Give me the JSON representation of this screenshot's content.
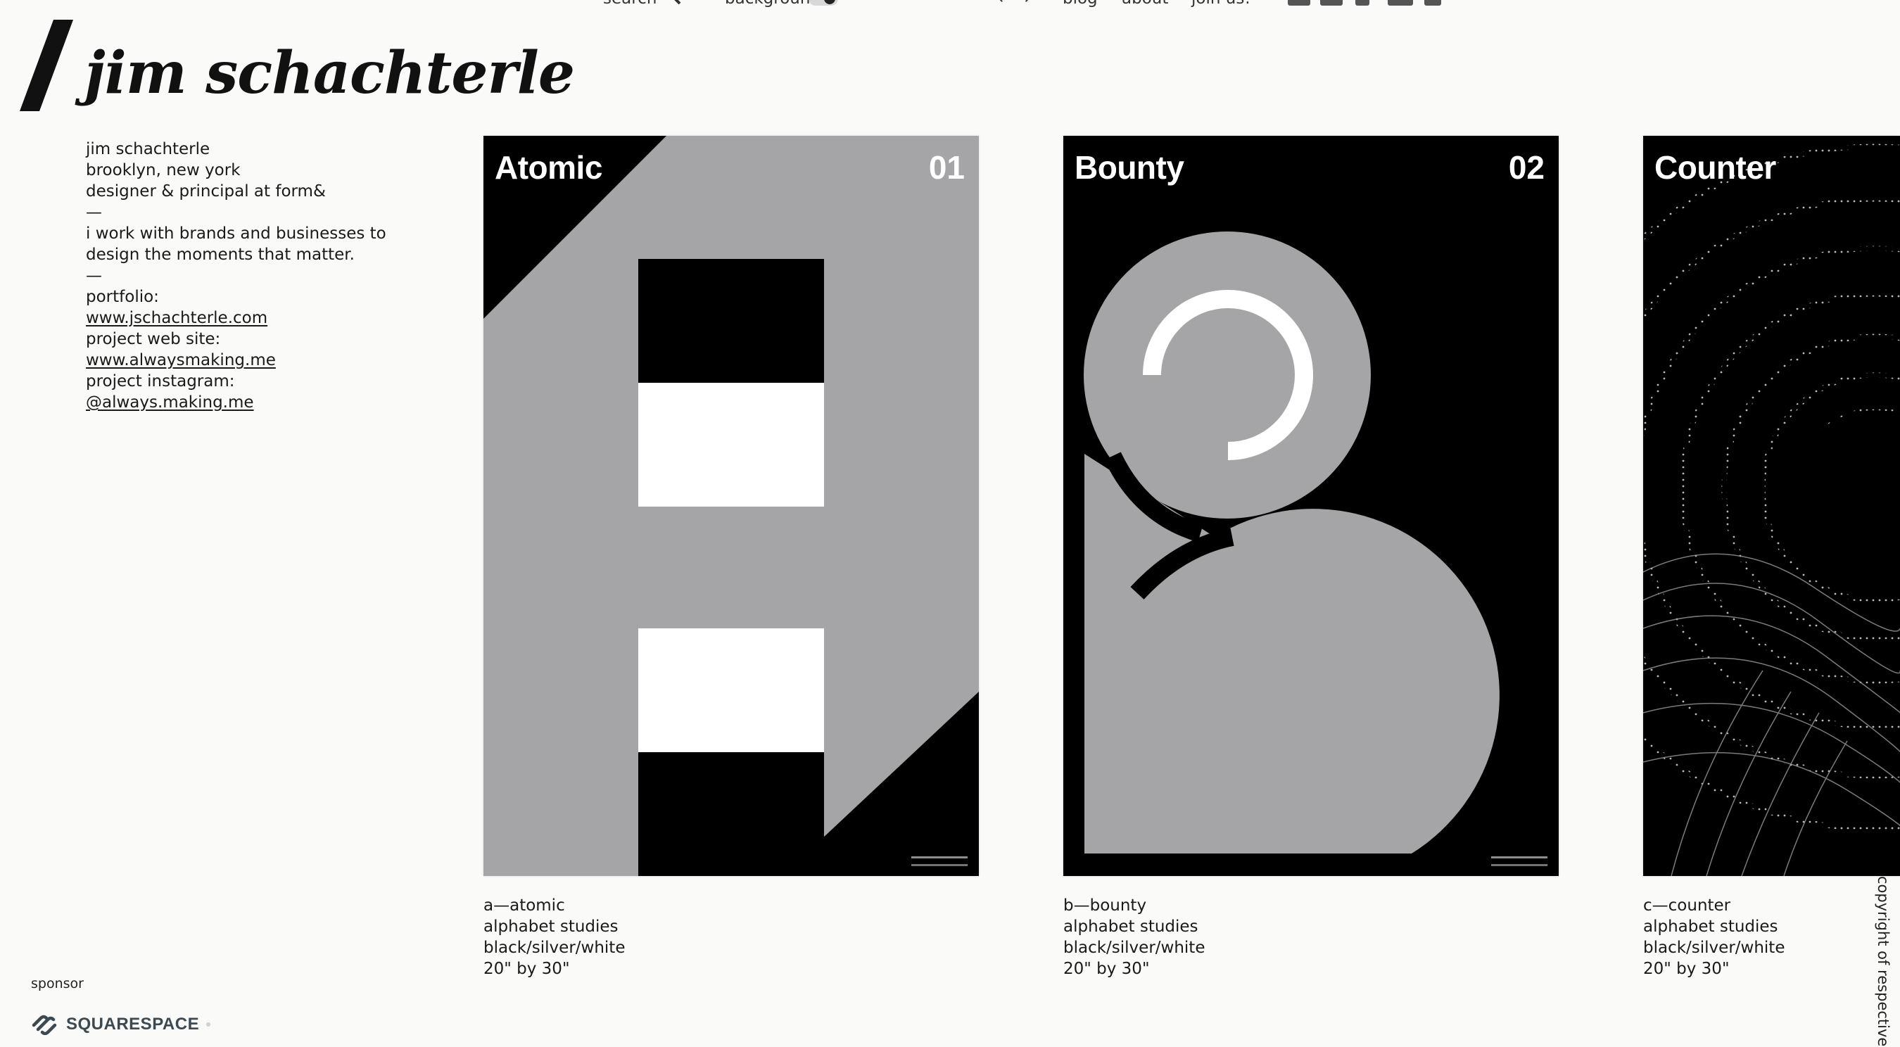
{
  "nav": {
    "search_label": "search",
    "background_label": "background",
    "blog_label": "blog",
    "about_label": "about",
    "join_label": "join us!",
    "arrows_label": "← →"
  },
  "header": {
    "site_title": "jim schachterle"
  },
  "bio": {
    "name": "jim schachterle",
    "location": "brooklyn, new york",
    "role": "designer & principal at form&",
    "dash1": "—",
    "statement_line1": "i work with brands and businesses to",
    "statement_line2": "design the moments that matter.",
    "dash2": "—",
    "portfolio_label": "portfolio:",
    "portfolio_link": "www.jschachterle.com",
    "project_site_label": "project web site:",
    "project_site_link": "www.alwaysmaking.me",
    "instagram_label": "project instagram:",
    "instagram_link": "@always.making.me"
  },
  "posters": [
    {
      "title": "Atomic",
      "number": "01",
      "caption": [
        "a—atomic",
        "alphabet studies",
        "black/silver/white",
        "20\" by 30\""
      ]
    },
    {
      "title": "Bounty",
      "number": "02",
      "caption": [
        "b—bounty",
        "alphabet studies",
        "black/silver/white",
        "20\" by 30\""
      ]
    },
    {
      "title": "Counter",
      "number": "",
      "caption": [
        "c—counter",
        "alphabet studies",
        "black/silver/white",
        "20\" by 30\""
      ]
    }
  ],
  "sponsor": {
    "label": "sponsor",
    "name": "SQUARESPACE"
  },
  "copyright": "copyright of respective aut",
  "colors": {
    "background": "#fafaf8",
    "poster_silver": "#a5a5a7",
    "poster_black": "#000000",
    "text": "#1a1a1a"
  }
}
